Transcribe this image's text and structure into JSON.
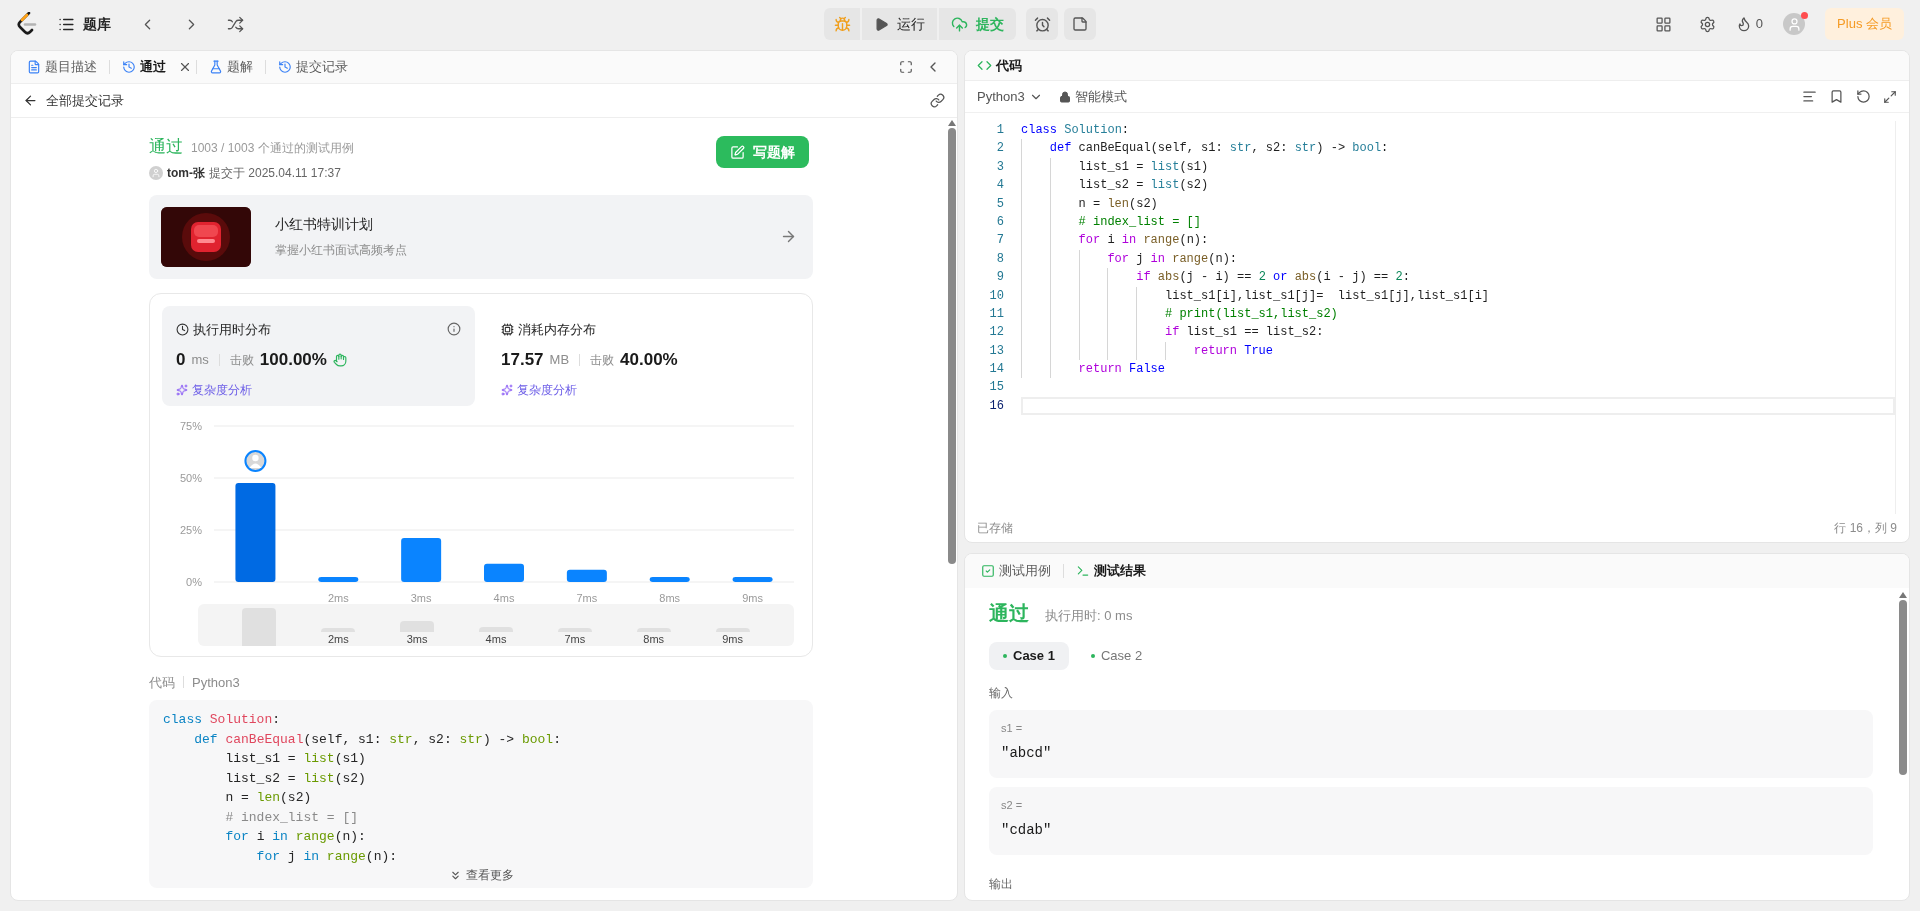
{
  "top_bar": {
    "problem_bank": "题库",
    "run": "运行",
    "submit": "提交",
    "streak": "0",
    "plus": "Plus 会员",
    "has_notification": true
  },
  "left_tabs": [
    {
      "label": "题目描述",
      "selected": false,
      "closable": false
    },
    {
      "label": "通过",
      "selected": true,
      "closable": true
    },
    {
      "label": "题解",
      "selected": false,
      "closable": false
    },
    {
      "label": "提交记录",
      "selected": false,
      "closable": false
    }
  ],
  "back_link": "全部提交记录",
  "submission": {
    "status": "通过",
    "cases": "1003 / 1003 个通过的测试用例",
    "user": "tom-张",
    "submitted": "提交于 2025.04.11 17:37",
    "write_button": "写题解"
  },
  "promo": {
    "title": "小红书特训计划",
    "subtitle": "掌握小红书面试高频考点"
  },
  "stats": [
    {
      "title": "执行用时分布",
      "value": "0",
      "unit": "ms",
      "beat_label": "击败",
      "beat": "100.00%",
      "link": "复杂度分析",
      "selected": true,
      "info": true,
      "celebrate": true
    },
    {
      "title": "消耗内存分布",
      "value": "17.57",
      "unit": "MB",
      "beat_label": "击败",
      "beat": "40.00%",
      "link": "复杂度分析",
      "selected": false,
      "info": false,
      "celebrate": false
    }
  ],
  "chart_data": {
    "type": "bar",
    "categories": [
      null,
      "2ms",
      "3ms",
      "4ms",
      "7ms",
      "8ms",
      "9ms"
    ],
    "values": [
      47.6,
      2.4,
      21.2,
      8.8,
      5.9,
      2.4,
      2.4
    ],
    "ylim": [
      0,
      75
    ],
    "yticks": [
      {
        "value": 0,
        "label": "0%"
      },
      {
        "value": 25,
        "label": "25%"
      },
      {
        "value": 50,
        "label": "50%"
      },
      {
        "value": 75,
        "label": "75%"
      }
    ]
  },
  "navigator": {
    "labels": [
      "2ms",
      "3ms",
      "4ms",
      "7ms",
      "8ms",
      "9ms"
    ]
  },
  "code_view": {
    "label": "代码",
    "language": "Python3",
    "more": "查看更多",
    "lines": [
      {
        "tokens": [
          {
            "kind": "kw",
            "text": "class "
          },
          {
            "kind": "cls",
            "text": "Solution"
          },
          {
            "kind": "p",
            "text": ":"
          }
        ]
      },
      {
        "tokens": [
          {
            "kind": "kw",
            "text": "    def "
          },
          {
            "kind": "fn",
            "text": "canBeEqual"
          },
          {
            "kind": "p",
            "text": "(self, s1: "
          },
          {
            "kind": "type",
            "text": "str"
          },
          {
            "kind": "p",
            "text": ", s2: "
          },
          {
            "kind": "type",
            "text": "str"
          },
          {
            "kind": "p",
            "text": ") -> "
          },
          {
            "kind": "type",
            "text": "bool"
          },
          {
            "kind": "p",
            "text": ":"
          }
        ]
      },
      {
        "tokens": [
          {
            "kind": "p",
            "text": "        list_s1 = "
          },
          {
            "kind": "type",
            "text": "list"
          },
          {
            "kind": "p",
            "text": "(s1)"
          }
        ]
      },
      {
        "tokens": [
          {
            "kind": "p",
            "text": "        list_s2 = "
          },
          {
            "kind": "type",
            "text": "list"
          },
          {
            "kind": "p",
            "text": "(s2)"
          }
        ]
      },
      {
        "tokens": [
          {
            "kind": "p",
            "text": "        n = "
          },
          {
            "kind": "call",
            "text": "len"
          },
          {
            "kind": "p",
            "text": "(s2)"
          }
        ]
      },
      {
        "tokens": [
          {
            "kind": "cm",
            "text": "        # index_list = []"
          }
        ]
      },
      {
        "tokens": [
          {
            "kind": "flow",
            "text": "        for "
          },
          {
            "kind": "p",
            "text": "i "
          },
          {
            "kind": "flow",
            "text": "in "
          },
          {
            "kind": "call",
            "text": "range"
          },
          {
            "kind": "p",
            "text": "(n):"
          }
        ]
      },
      {
        "tokens": [
          {
            "kind": "flow",
            "text": "            for "
          },
          {
            "kind": "p",
            "text": "j "
          },
          {
            "kind": "flow",
            "text": "in "
          },
          {
            "kind": "call",
            "text": "range"
          },
          {
            "kind": "p",
            "text": "(n):"
          }
        ]
      }
    ]
  },
  "editor": {
    "title": "代码",
    "language": "Python3",
    "mode": "智能模式",
    "saved": "已存储",
    "cursor": "行 16，列 9",
    "lines": [
      {
        "no": "1",
        "current": false,
        "tokens": [
          {
            "kind": "kw",
            "text": "class "
          },
          {
            "kind": "cls",
            "text": "Solution"
          },
          {
            "kind": "p",
            "text": ":"
          }
        ]
      },
      {
        "no": "2",
        "current": false,
        "tokens": [
          {
            "kind": "kw",
            "text": "    def "
          },
          {
            "kind": "fn",
            "text": "canBeEqual"
          },
          {
            "kind": "p",
            "text": "(self, s1: "
          },
          {
            "kind": "type",
            "text": "str"
          },
          {
            "kind": "p",
            "text": ", s2: "
          },
          {
            "kind": "type",
            "text": "str"
          },
          {
            "kind": "p",
            "text": ") -> "
          },
          {
            "kind": "type",
            "text": "bool"
          },
          {
            "kind": "p",
            "text": ":"
          }
        ]
      },
      {
        "no": "3",
        "current": false,
        "tokens": [
          {
            "kind": "p",
            "text": "        list_s1 = "
          },
          {
            "kind": "type",
            "text": "list"
          },
          {
            "kind": "p",
            "text": "(s1)"
          }
        ]
      },
      {
        "no": "4",
        "current": false,
        "tokens": [
          {
            "kind": "p",
            "text": "        list_s2 = "
          },
          {
            "kind": "type",
            "text": "list"
          },
          {
            "kind": "p",
            "text": "(s2)"
          }
        ]
      },
      {
        "no": "5",
        "current": false,
        "tokens": [
          {
            "kind": "p",
            "text": "        n = "
          },
          {
            "kind": "call",
            "text": "len"
          },
          {
            "kind": "p",
            "text": "(s2)"
          }
        ]
      },
      {
        "no": "6",
        "current": false,
        "tokens": [
          {
            "kind": "cm",
            "text": "        # index_list = []"
          }
        ]
      },
      {
        "no": "7",
        "current": false,
        "tokens": [
          {
            "kind": "flow",
            "text": "        for "
          },
          {
            "kind": "p",
            "text": "i "
          },
          {
            "kind": "flow",
            "text": "in "
          },
          {
            "kind": "call",
            "text": "range"
          },
          {
            "kind": "p",
            "text": "(n):"
          }
        ]
      },
      {
        "no": "8",
        "current": false,
        "tokens": [
          {
            "kind": "flow",
            "text": "            for "
          },
          {
            "kind": "p",
            "text": "j "
          },
          {
            "kind": "flow",
            "text": "in "
          },
          {
            "kind": "call",
            "text": "range"
          },
          {
            "kind": "p",
            "text": "(n):"
          }
        ]
      },
      {
        "no": "9",
        "current": false,
        "tokens": [
          {
            "kind": "flow",
            "text": "                if "
          },
          {
            "kind": "call",
            "text": "abs"
          },
          {
            "kind": "p",
            "text": "(j - i) == "
          },
          {
            "kind": "num",
            "text": "2"
          },
          {
            "kind": "kw",
            "text": " or "
          },
          {
            "kind": "call",
            "text": "abs"
          },
          {
            "kind": "p",
            "text": "(i - j) == "
          },
          {
            "kind": "num",
            "text": "2"
          },
          {
            "kind": "p",
            "text": ":"
          }
        ]
      },
      {
        "no": "10",
        "current": false,
        "tokens": [
          {
            "kind": "p",
            "text": "                    list_s1[i],list_s1[j]=  list_s1[j],list_s1[i]"
          }
        ]
      },
      {
        "no": "11",
        "current": false,
        "tokens": [
          {
            "kind": "cm",
            "text": "                    # print(list_s1,list_s2)"
          }
        ]
      },
      {
        "no": "12",
        "current": false,
        "tokens": [
          {
            "kind": "flow",
            "text": "                    if "
          },
          {
            "kind": "p",
            "text": "list_s1 == list_s2:"
          }
        ]
      },
      {
        "no": "13",
        "current": false,
        "tokens": [
          {
            "kind": "flow",
            "text": "                        return "
          },
          {
            "kind": "kw",
            "text": "True"
          }
        ]
      },
      {
        "no": "14",
        "current": false,
        "tokens": [
          {
            "kind": "flow",
            "text": "        return "
          },
          {
            "kind": "kw",
            "text": "False"
          }
        ]
      },
      {
        "no": "15",
        "current": false
      },
      {
        "no": "16",
        "current": true
      }
    ]
  },
  "test_panel": {
    "tabs": [
      {
        "label": "测试用例",
        "selected": false
      },
      {
        "label": "测试结果",
        "selected": true
      }
    ],
    "status": "通过",
    "runtime": "执行用时: 0 ms",
    "cases": [
      {
        "label": "Case 1",
        "selected": true
      },
      {
        "label": "Case 2",
        "selected": false
      }
    ],
    "input_label": "输入",
    "inputs": [
      {
        "name": "s1 =",
        "value": "\"abcd\""
      },
      {
        "name": "s2 =",
        "value": "\"cdab\""
      }
    ],
    "output_label": "输出"
  }
}
